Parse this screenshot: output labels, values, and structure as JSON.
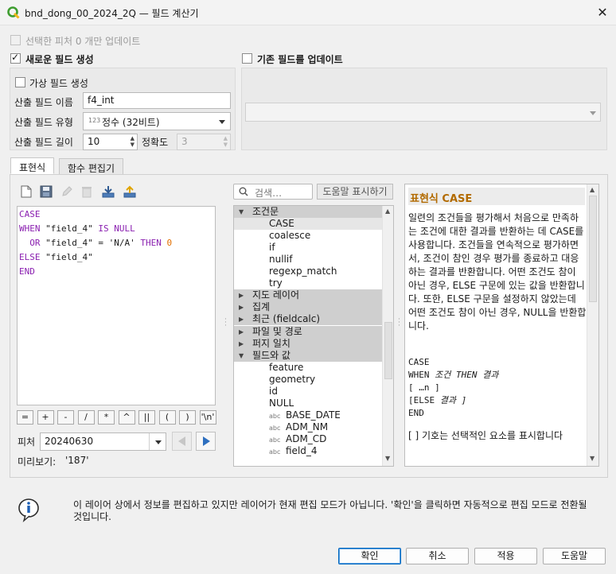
{
  "window": {
    "title": "bnd_dong_00_2024_2Q — 필드 계산기",
    "close_glyph": "✕"
  },
  "only_selected": {
    "label": "선택한 피처 0 개만 업데이트",
    "checked": false,
    "enabled": false
  },
  "new_field": {
    "label": "새로운 필드 생성",
    "checked": true,
    "virtual_label": "가상 필드 생성",
    "name_label": "산출 필드 이름",
    "name_value": "f4_int",
    "type_label": "산출 필드 유형",
    "type_badge": "123",
    "type_value": "정수 (32비트)",
    "length_label": "산출 필드 길이",
    "length_value": "10",
    "precision_label": "정확도",
    "precision_value": "3"
  },
  "update_field": {
    "label": "기존 필드를 업데이트",
    "checked": false
  },
  "tabs": [
    "표현식",
    "함수 편집기"
  ],
  "expression_lines": [
    [
      {
        "t": "CASE",
        "c": "kw"
      }
    ],
    [
      {
        "t": "WHEN ",
        "c": "kw"
      },
      {
        "t": "\"field_4\"",
        "c": "str"
      },
      {
        "t": " IS NULL",
        "c": "kw"
      }
    ],
    [
      {
        "t": "  OR ",
        "c": "kw"
      },
      {
        "t": "\"field_4\"",
        "c": "str"
      },
      {
        "t": " = ",
        "c": "op"
      },
      {
        "t": "'N/A'",
        "c": "str"
      },
      {
        "t": " THEN ",
        "c": "kw"
      },
      {
        "t": "0",
        "c": "num"
      }
    ],
    [
      {
        "t": "ELSE ",
        "c": "kw"
      },
      {
        "t": "\"field_4\"",
        "c": "str"
      }
    ],
    [
      {
        "t": "END",
        "c": "kw"
      }
    ]
  ],
  "operators": [
    "=",
    "+",
    "-",
    "/",
    "*",
    "^",
    "||",
    "(",
    ")",
    "'\\n'"
  ],
  "feature_label": "피처",
  "feature_value": "20240630",
  "preview_label": "미리보기:",
  "preview_value": "'187'",
  "search_placeholder": "검색…",
  "show_help_label": "도움말 표시하기",
  "tree": [
    {
      "label": "조건문",
      "group": true,
      "expanded": true
    },
    {
      "label": "CASE",
      "group": false,
      "selected": true
    },
    {
      "label": "coalesce",
      "group": false
    },
    {
      "label": "if",
      "group": false
    },
    {
      "label": "nullif",
      "group": false
    },
    {
      "label": "regexp_match",
      "group": false
    },
    {
      "label": "try",
      "group": false
    },
    {
      "label": "지도 레이어",
      "group": true,
      "expanded": false
    },
    {
      "label": "집계",
      "group": true,
      "expanded": false
    },
    {
      "label": "최근 (fieldcalc)",
      "group": true,
      "expanded": false
    },
    {
      "label": "파일 및 경로",
      "group": true,
      "expanded": false
    },
    {
      "label": "퍼지 일치",
      "group": true,
      "expanded": false
    },
    {
      "label": "필드와 값",
      "group": true,
      "expanded": true
    },
    {
      "label": "feature",
      "group": false
    },
    {
      "label": "geometry",
      "group": false
    },
    {
      "label": "id",
      "group": false
    },
    {
      "label": "NULL",
      "group": false
    },
    {
      "label": "BASE_DATE",
      "group": false,
      "abc": "abc"
    },
    {
      "label": "ADM_NM",
      "group": false,
      "abc": "abc"
    },
    {
      "label": "ADM_CD",
      "group": false,
      "abc": "abc"
    },
    {
      "label": "field_4",
      "group": false,
      "abc": "abc"
    }
  ],
  "help": {
    "title": "표현식 CASE",
    "body": "일련의 조건들을 평가해서 처음으로 만족하는 조건에 대한 결과를 반환하는 데 CASE를 사용합니다. 조건들을 연속적으로 평가하면서, 조건이 참인 경우 평가를 종료하고 대응하는 결과를 반환합니다. 어떤 조건도 참이 아닌 경우, ELSE 구문에 있는 값을 반환합니다. 또한, ELSE 구문을 설정하지 않았는데 어떤 조건도 참이 아닌 경우, NULL을 반환합니다.",
    "syntax": [
      {
        "kw": "CASE",
        "rest": ""
      },
      {
        "kw": "WHEN",
        "rest": "조건 THEN 결과"
      },
      {
        "kw": "[ …n ]",
        "rest": ""
      },
      {
        "kw": "[ELSE",
        "rest": "결과 ]"
      },
      {
        "kw": "END",
        "rest": ""
      }
    ],
    "note": "[ ] 기호는 선택적인 요소를 표시합니다"
  },
  "info_message": "이 레이어 상에서 정보를 편집하고 있지만 레이어가 현재 편집 모드가 아닙니다. '확인'을 클릭하면 자동적으로 편집 모드로 전환될 것입니다.",
  "buttons": {
    "ok": "확인",
    "cancel": "취소",
    "apply": "적용",
    "help": "도움말"
  },
  "colors": {
    "keyword": "#8a1fb0",
    "string": "#1a1a1a",
    "number": "#e27000",
    "group_bg": "#cfcfcf",
    "help_title": "#b26a00"
  }
}
